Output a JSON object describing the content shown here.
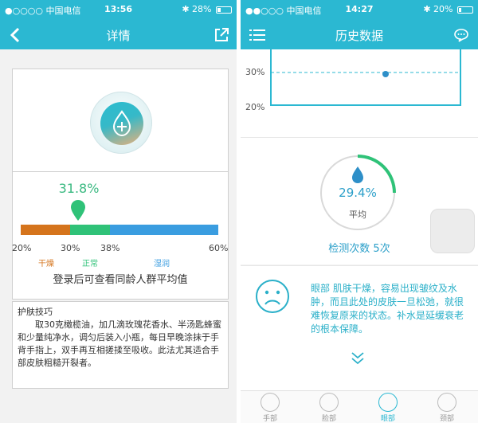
{
  "left": {
    "status": {
      "carrier": "●○○○○ 中国电信",
      "time": "13:56",
      "battery": "28%",
      "battery_level": 0.28
    },
    "nav": {
      "title": "详情"
    },
    "result": {
      "value_label": "31.8%",
      "value": 31.8,
      "scale_min": 20,
      "scale_max": 60,
      "ticks": [
        "20%",
        "30%",
        "38%",
        "60%"
      ],
      "zones": [
        {
          "label": "干燥",
          "from": 20,
          "to": 30,
          "color": "#d5741c"
        },
        {
          "label": "正常",
          "from": 30,
          "to": 38,
          "color": "#2fc278"
        },
        {
          "label": "湿润",
          "from": 38,
          "to": 60,
          "color": "#3a9de0"
        }
      ],
      "login_tip": "登录后可查看同龄人群平均值"
    },
    "tips": {
      "title": "护肤技巧",
      "body": "取30克橄榄油，加几滴玫瑰花香水、半汤匙蜂蜜和少量纯净水，调匀后装入小瓶，每日早晚涂抹于手背手指上，双手再互相搓揉至吸收。此法尤其适合手部皮肤粗糙开裂者。"
    }
  },
  "right": {
    "status": {
      "carrier": "●●○○○ 中国电信",
      "time": "14:27",
      "battery": "20%",
      "battery_level": 0.2
    },
    "nav": {
      "title": "历史数据"
    },
    "chart": {
      "y_labels": [
        "30%",
        "20%"
      ],
      "point_value": 30
    },
    "average": {
      "value_label": "29.4%",
      "caption": "平均",
      "progress": 0.25,
      "count_label": "检测次数 5次"
    },
    "tips": {
      "text": "眼部 肌肤干燥，容易出现皱纹及水肿，而且此处的皮肤一旦松弛，就很难恢复原来的状态。补水是延缓衰老的根本保障。"
    },
    "tabs": [
      {
        "label": "手部",
        "active": false
      },
      {
        "label": "脸部",
        "active": false
      },
      {
        "label": "眼部",
        "active": true
      },
      {
        "label": "颈部",
        "active": false
      }
    ]
  }
}
